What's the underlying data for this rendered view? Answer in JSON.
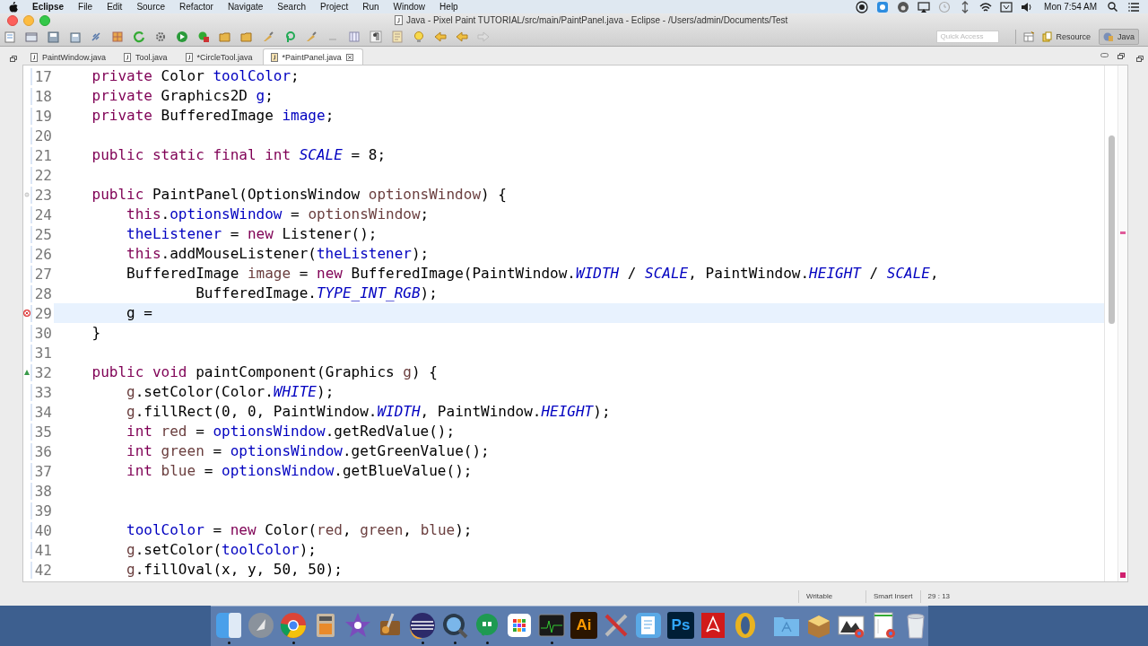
{
  "menubar": {
    "app": "Eclipse",
    "menus": [
      "File",
      "Edit",
      "Source",
      "Refactor",
      "Navigate",
      "Search",
      "Project",
      "Run",
      "Window",
      "Help"
    ],
    "status_icons": [
      {
        "kind": "record"
      },
      {
        "kind": "screen"
      },
      {
        "kind": "beats"
      },
      {
        "kind": "airplay"
      },
      {
        "kind": "history"
      },
      {
        "kind": "network"
      },
      {
        "kind": "wifi"
      },
      {
        "kind": "keyboard"
      },
      {
        "kind": "volume"
      }
    ],
    "clock": "Mon 7:54 AM"
  },
  "window": {
    "title": "Java - Pixel Paint TUTORIAL/src/main/PaintPanel.java - Eclipse - /Users/admin/Documents/Test"
  },
  "toolbar": {
    "icons": [
      {
        "kind": "new"
      },
      {
        "kind": "open"
      },
      {
        "kind": "save"
      },
      {
        "kind": "saveall"
      },
      {
        "kind": "link"
      },
      {
        "kind": "box"
      },
      {
        "kind": "refresh"
      },
      {
        "kind": "gear"
      },
      {
        "kind": "run"
      },
      {
        "kind": "debug"
      },
      {
        "kind": "folder"
      },
      {
        "kind": "folder"
      },
      {
        "kind": "brush"
      },
      {
        "kind": "search"
      },
      {
        "kind": "brush"
      },
      {
        "kind": "dash"
      },
      {
        "kind": "grid"
      },
      {
        "kind": "para"
      },
      {
        "kind": "page"
      },
      {
        "kind": "bulb"
      },
      {
        "kind": "back"
      },
      {
        "kind": "back"
      },
      {
        "kind": "forward"
      }
    ],
    "quick_access": {
      "placeholder": "Quick Access"
    },
    "perspectives": [
      {
        "label": "Resource",
        "selected": false
      },
      {
        "label": "Java",
        "selected": true
      }
    ]
  },
  "tabs": [
    {
      "label": "PaintWindow.java",
      "selected": false
    },
    {
      "label": "Tool.java",
      "selected": false
    },
    {
      "label": "*CircleTool.java",
      "selected": false
    },
    {
      "label": "*PaintPanel.java",
      "selected": true
    }
  ],
  "editor": {
    "lines": [
      {
        "number": "17",
        "current": false,
        "tokens": [
          {
            "kind": "keyword",
            "text": "    private"
          },
          {
            "kind": "plain",
            "text": " Color "
          },
          {
            "kind": "field",
            "text": "toolColor"
          },
          {
            "kind": "plain",
            "text": ";"
          }
        ]
      },
      {
        "number": "18",
        "current": false,
        "tokens": [
          {
            "kind": "keyword",
            "text": "    private"
          },
          {
            "kind": "plain",
            "text": " Graphics2D "
          },
          {
            "kind": "field",
            "text": "g"
          },
          {
            "kind": "plain",
            "text": ";"
          }
        ]
      },
      {
        "number": "19",
        "current": false,
        "tokens": [
          {
            "kind": "keyword",
            "text": "    private"
          },
          {
            "kind": "plain",
            "text": " BufferedImage "
          },
          {
            "kind": "field",
            "text": "image"
          },
          {
            "kind": "plain",
            "text": ";"
          }
        ]
      },
      {
        "number": "20",
        "current": false
      },
      {
        "number": "21",
        "current": false,
        "tokens": [
          {
            "kind": "keyword",
            "text": "    public static final int "
          },
          {
            "kind": "constant",
            "text": "SCALE"
          },
          {
            "kind": "plain",
            "text": " = 8;"
          }
        ]
      },
      {
        "number": "22",
        "current": false
      },
      {
        "number": "23",
        "current": false,
        "marker": {
          "kind": "fold"
        },
        "tokens": [
          {
            "kind": "keyword",
            "text": "    public"
          },
          {
            "kind": "plain",
            "text": " PaintPanel(OptionsWindow "
          },
          {
            "kind": "local",
            "text": "optionsWindow"
          },
          {
            "kind": "plain",
            "text": ") {"
          }
        ]
      },
      {
        "number": "24",
        "current": false,
        "tokens": [
          {
            "kind": "keyword",
            "text": "        this"
          },
          {
            "kind": "plain",
            "text": "."
          },
          {
            "kind": "field",
            "text": "optionsWindow"
          },
          {
            "kind": "plain",
            "text": " = "
          },
          {
            "kind": "local",
            "text": "optionsWindow"
          },
          {
            "kind": "plain",
            "text": ";"
          }
        ]
      },
      {
        "number": "25",
        "current": false,
        "tokens": [
          {
            "kind": "field",
            "text": "        theListener"
          },
          {
            "kind": "plain",
            "text": " = "
          },
          {
            "kind": "keyword",
            "text": "new"
          },
          {
            "kind": "plain",
            "text": " Listener();"
          }
        ]
      },
      {
        "number": "26",
        "current": false,
        "tokens": [
          {
            "kind": "keyword",
            "text": "        this"
          },
          {
            "kind": "plain",
            "text": ".addMouseListener("
          },
          {
            "kind": "field",
            "text": "theListener"
          },
          {
            "kind": "plain",
            "text": ");"
          }
        ]
      },
      {
        "number": "27",
        "current": false,
        "tokens": [
          {
            "kind": "plain",
            "text": "        BufferedImage "
          },
          {
            "kind": "local",
            "text": "image"
          },
          {
            "kind": "plain",
            "text": " = "
          },
          {
            "kind": "keyword",
            "text": "new"
          },
          {
            "kind": "plain",
            "text": " BufferedImage(PaintWindow."
          },
          {
            "kind": "constant",
            "text": "WIDTH"
          },
          {
            "kind": "plain",
            "text": " / "
          },
          {
            "kind": "constant",
            "text": "SCALE"
          },
          {
            "kind": "plain",
            "text": ", PaintWindow."
          },
          {
            "kind": "constant",
            "text": "HEIGHT"
          },
          {
            "kind": "plain",
            "text": " / "
          },
          {
            "kind": "constant",
            "text": "SCALE"
          },
          {
            "kind": "plain",
            "text": ","
          }
        ]
      },
      {
        "number": "28",
        "current": false,
        "tokens": [
          {
            "kind": "plain",
            "text": "                BufferedImage."
          },
          {
            "kind": "constant",
            "text": "TYPE_INT_RGB"
          },
          {
            "kind": "plain",
            "text": ");"
          }
        ]
      },
      {
        "number": "29",
        "current": true,
        "marker": {
          "kind": "error"
        },
        "tokens": [
          {
            "kind": "plain",
            "text": "        g ="
          }
        ]
      },
      {
        "number": "30",
        "current": false,
        "tokens": [
          {
            "kind": "plain",
            "text": "    }"
          }
        ]
      },
      {
        "number": "31",
        "current": false
      },
      {
        "number": "32",
        "current": false,
        "marker": {
          "kind": "override"
        },
        "tokens": [
          {
            "kind": "keyword",
            "text": "    public void"
          },
          {
            "kind": "plain",
            "text": " paintComponent(Graphics "
          },
          {
            "kind": "local",
            "text": "g"
          },
          {
            "kind": "plain",
            "text": ") {"
          }
        ]
      },
      {
        "number": "33",
        "current": false,
        "tokens": [
          {
            "kind": "local",
            "text": "        g"
          },
          {
            "kind": "plain",
            "text": ".setColor(Color."
          },
          {
            "kind": "constant",
            "text": "WHITE"
          },
          {
            "kind": "plain",
            "text": ");"
          }
        ]
      },
      {
        "number": "34",
        "current": false,
        "tokens": [
          {
            "kind": "local",
            "text": "        g"
          },
          {
            "kind": "plain",
            "text": ".fillRect(0, 0, PaintWindow."
          },
          {
            "kind": "constant",
            "text": "WIDTH"
          },
          {
            "kind": "plain",
            "text": ", PaintWindow."
          },
          {
            "kind": "constant",
            "text": "HEIGHT"
          },
          {
            "kind": "plain",
            "text": ");"
          }
        ]
      },
      {
        "number": "35",
        "current": false,
        "tokens": [
          {
            "kind": "keyword",
            "text": "        int "
          },
          {
            "kind": "local",
            "text": "red"
          },
          {
            "kind": "plain",
            "text": " = "
          },
          {
            "kind": "field",
            "text": "optionsWindow"
          },
          {
            "kind": "plain",
            "text": ".getRedValue();"
          }
        ]
      },
      {
        "number": "36",
        "current": false,
        "tokens": [
          {
            "kind": "keyword",
            "text": "        int "
          },
          {
            "kind": "local",
            "text": "green"
          },
          {
            "kind": "plain",
            "text": " = "
          },
          {
            "kind": "field",
            "text": "optionsWindow"
          },
          {
            "kind": "plain",
            "text": ".getGreenValue();"
          }
        ]
      },
      {
        "number": "37",
        "current": false,
        "tokens": [
          {
            "kind": "keyword",
            "text": "        int "
          },
          {
            "kind": "local",
            "text": "blue"
          },
          {
            "kind": "plain",
            "text": " = "
          },
          {
            "kind": "field",
            "text": "optionsWindow"
          },
          {
            "kind": "plain",
            "text": ".getBlueValue();"
          }
        ]
      },
      {
        "number": "38",
        "current": false
      },
      {
        "number": "39",
        "current": false
      },
      {
        "number": "40",
        "current": false,
        "tokens": [
          {
            "kind": "field",
            "text": "        toolColor"
          },
          {
            "kind": "plain",
            "text": " = "
          },
          {
            "kind": "keyword",
            "text": "new"
          },
          {
            "kind": "plain",
            "text": " Color("
          },
          {
            "kind": "local",
            "text": "red"
          },
          {
            "kind": "plain",
            "text": ", "
          },
          {
            "kind": "local",
            "text": "green"
          },
          {
            "kind": "plain",
            "text": ", "
          },
          {
            "kind": "local",
            "text": "blue"
          },
          {
            "kind": "plain",
            "text": ");"
          }
        ]
      },
      {
        "number": "41",
        "current": false,
        "tokens": [
          {
            "kind": "local",
            "text": "        g"
          },
          {
            "kind": "plain",
            "text": ".setColor("
          },
          {
            "kind": "field",
            "text": "toolColor"
          },
          {
            "kind": "plain",
            "text": ");"
          }
        ]
      },
      {
        "number": "42",
        "current": false,
        "tokens": [
          {
            "kind": "local",
            "text": "        g"
          },
          {
            "kind": "plain",
            "text": ".fillOval(x, y, 50, 50);"
          }
        ]
      }
    ]
  },
  "status_bar": [
    "Writable",
    "Smart Insert",
    "29 : 13"
  ],
  "dock": [
    {
      "kind": "finder",
      "running": true
    },
    {
      "kind": "rocket",
      "running": false
    },
    {
      "kind": "browser",
      "running": true
    },
    {
      "kind": "calculator",
      "running": false
    },
    {
      "kind": "star",
      "running": false
    },
    {
      "kind": "guitar",
      "running": false
    },
    {
      "kind": "planet",
      "running": true
    },
    {
      "kind": "magnifier",
      "running": true
    },
    {
      "kind": "chat",
      "running": true
    },
    {
      "kind": "grid",
      "running": false
    },
    {
      "kind": "monitor",
      "running": true
    },
    {
      "kind": "letters",
      "label": "Ai",
      "running": false
    },
    {
      "kind": "tools",
      "running": false
    },
    {
      "kind": "notepad",
      "running": false
    },
    {
      "kind": "letters",
      "label": "Ps",
      "running": false
    },
    {
      "kind": "pdf",
      "running": false
    },
    {
      "kind": "ring",
      "running": false
    },
    {
      "kind": "separator"
    },
    {
      "kind": "folder",
      "running": false
    },
    {
      "kind": "box",
      "running": false
    },
    {
      "kind": "screenshot",
      "running": false
    },
    {
      "kind": "sheet",
      "running": false
    },
    {
      "kind": "trash",
      "running": false
    }
  ]
}
